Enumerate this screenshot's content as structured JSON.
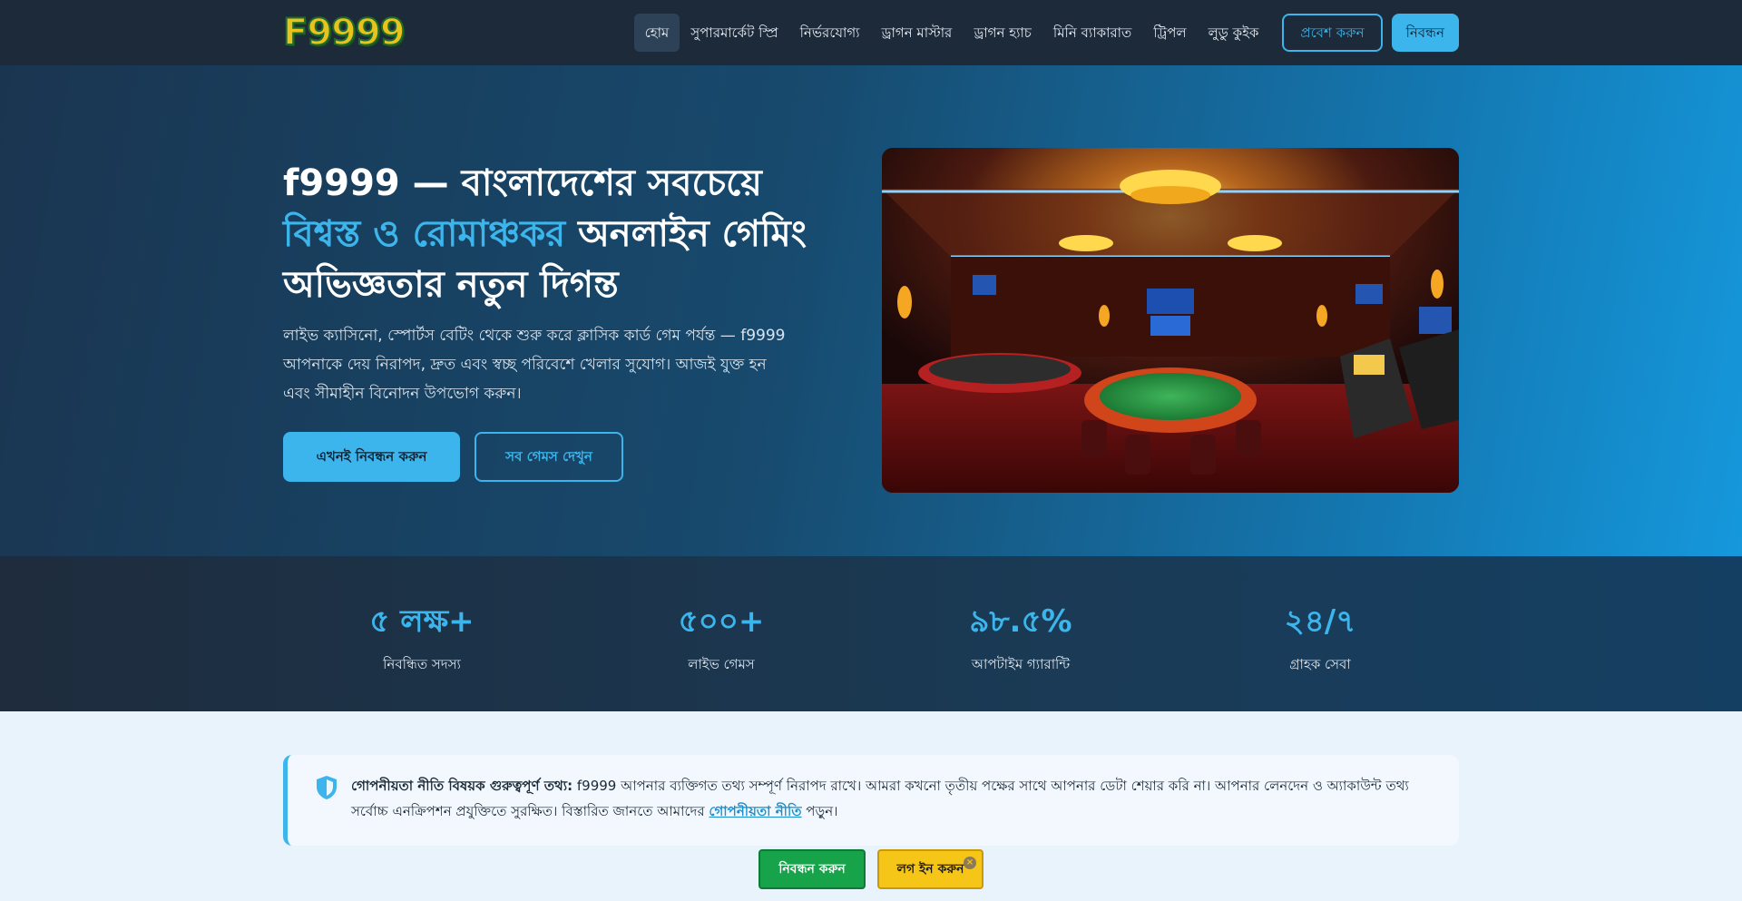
{
  "nav": {
    "logo": "F9999",
    "items": [
      {
        "label": "হোম",
        "active": true
      },
      {
        "label": "সুপারমার্কেট স্প্রি"
      },
      {
        "label": "নির্ভরযোগ্য"
      },
      {
        "label": "ড্রাগন মাস্টার"
      },
      {
        "label": "ড্রাগন হ্যাচ"
      },
      {
        "label": "মিনি ব্যাকারাত"
      },
      {
        "label": "ট্রিপল"
      },
      {
        "label": "লুডু কুইক"
      }
    ],
    "login_label": "প্রবেশ করুন",
    "register_label": "নিবন্ধন"
  },
  "hero": {
    "title_part1": "f9999 — বাংলাদেশের সবচেয়ে ",
    "title_highlight": "বিশ্বস্ত ও রোমাঞ্চকর",
    "title_part2": " অনলাইন গেমিং অভিজ্ঞতার নতুন দিগন্ত",
    "subtitle": "লাইভ ক্যাসিনো, স্পোর্টস বেটিং থেকে শুরু করে ক্লাসিক কার্ড গেম পর্যন্ত — f9999 আপনাকে দেয় নিরাপদ, দ্রুত এবং স্বচ্ছ পরিবেশে খেলার সুযোগ। আজই যুক্ত হন এবং সীমাহীন বিনোদন উপভোগ করুন।",
    "primary_cta": "এখনই নিবন্ধন করুন",
    "secondary_cta": "সব গেমস দেখুন"
  },
  "stats": [
    {
      "value": "৫ লক্ষ+",
      "label": "নিবন্ধিত সদস্য"
    },
    {
      "value": "৫০০+",
      "label": "লাইভ গেমস"
    },
    {
      "value": "৯৮.৫%",
      "label": "আপটাইম গ্যারান্টি"
    },
    {
      "value": "২৪/৭",
      "label": "গ্রাহক সেবা"
    }
  ],
  "notice": {
    "heading": "গোপনীয়তা নীতি বিষয়ক গুরুত্বপূর্ণ তথ্য:",
    "body": " f9999 আপনার ব্যক্তিগত তথ্য সম্পূর্ণ নিরাপদ রাখে। আমরা কখনো তৃতীয় পক্ষের সাথে আপনার ডেটা শেয়ার করি না। আপনার লেনদেন ও অ্যাকাউন্ট তথ্য সর্বোচ্চ এনক্রিপশন প্রযুক্তিতে সুরক্ষিত। বিস্তারিত জানতে আমাদের ",
    "link_text": "গোপনীয়তা নীতি",
    "tail": " পড়ুন।"
  },
  "floating": {
    "register_label": "নিবন্ধন করুন",
    "login_label": "লগ ইন করুন",
    "close_glyph": "×"
  },
  "colors": {
    "accent": "#3bb5ec",
    "nav_bg": "#1d2a3a",
    "green_button": "#16a34a",
    "yellow_button": "#f5c518"
  },
  "icons": {
    "notice": "shield-icon"
  }
}
